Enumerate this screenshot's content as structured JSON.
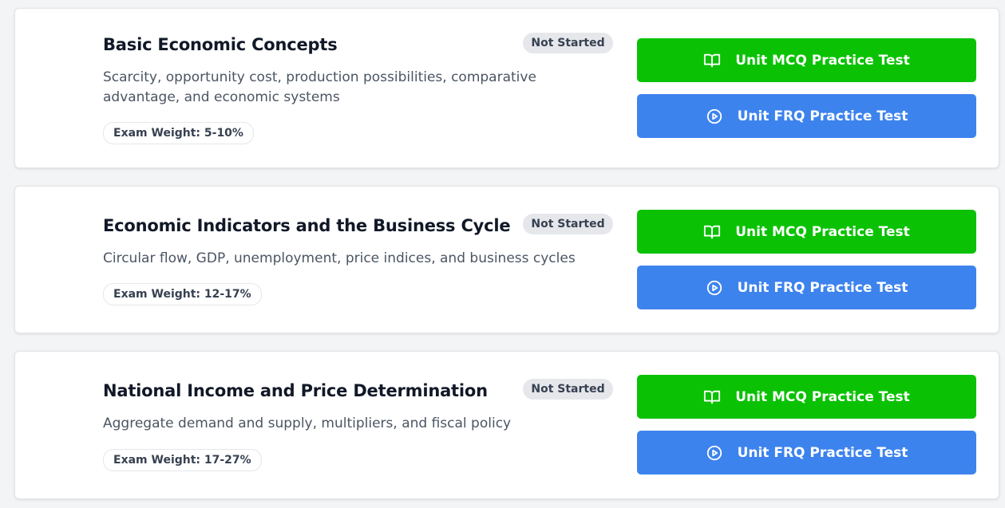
{
  "units": [
    {
      "title": "Basic Economic Concepts",
      "status": "Not Started",
      "description": "Scarcity, opportunity cost, production possibilities, comparative advantage, and economic systems",
      "weight": "Exam Weight: 5-10%",
      "mcq_label": "Unit MCQ Practice Test",
      "frq_label": "Unit FRQ Practice Test"
    },
    {
      "title": "Economic Indicators and the Business Cycle",
      "status": "Not Started",
      "description": "Circular flow, GDP, unemployment, price indices, and business cycles",
      "weight": "Exam Weight: 12-17%",
      "mcq_label": "Unit MCQ Practice Test",
      "frq_label": "Unit FRQ Practice Test"
    },
    {
      "title": "National Income and Price Determination",
      "status": "Not Started",
      "description": "Aggregate demand and supply, multipliers, and fiscal policy",
      "weight": "Exam Weight: 17-27%",
      "mcq_label": "Unit MCQ Practice Test",
      "frq_label": "Unit FRQ Practice Test"
    }
  ],
  "icons": {
    "mcq": "book-open-icon",
    "frq": "play-circle-icon"
  },
  "colors": {
    "mcq_button": "#0ac203",
    "frq_button": "#3d83ee",
    "badge_bg": "#e5e7eb",
    "page_bg": "#f3f4f6"
  }
}
